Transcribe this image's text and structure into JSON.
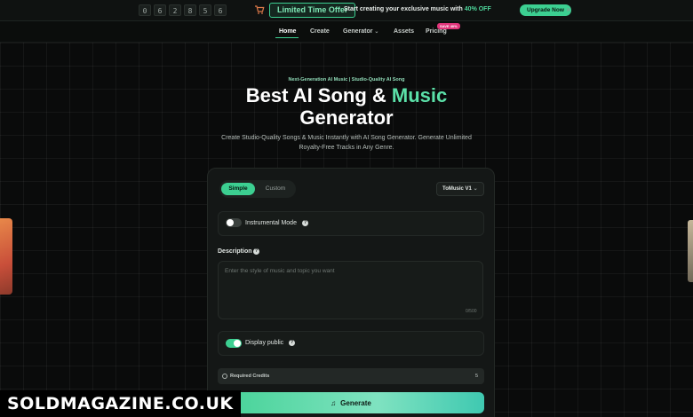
{
  "promo": {
    "countdown": [
      "0",
      "6",
      "2",
      "8",
      "5",
      "6"
    ],
    "offer_label": "Limited Time Offer",
    "text_before": "Start creating your exclusive music with ",
    "text_highlight": "40% OFF",
    "upgrade_label": "Upgrade Now",
    "close_symbol": "×"
  },
  "nav": {
    "items": [
      "Home",
      "Create",
      "Generator",
      "Assets",
      "Pricing"
    ],
    "pricing_badge": "SAVE 40%"
  },
  "hero": {
    "eyebrow": "Next-Generation AI Music | Studio-Quality AI Song",
    "title_part1": "Best AI Song & ",
    "title_accent": "Music",
    "title_part2": "Generator",
    "subtitle": "Create Studio-Quality Songs & Music Instantly with AI Song Generator. Generate Unlimited Royalty-Free Tracks in Any Genre."
  },
  "form": {
    "tabs": [
      "Simple",
      "Custom"
    ],
    "model": "ToMusic V1",
    "instrumental_label": "Instrumental Mode",
    "instrumental_on": false,
    "description_label": "Description",
    "description_placeholder": "Enter the style of music and topic you want",
    "char_count": "0/500",
    "display_public_label": "Display public",
    "display_public_on": true,
    "credits_label": "Required Credits",
    "credits_value": "5",
    "generate_label": "Generate"
  },
  "watermark": "SOLDMAGAZINE.CO.UK",
  "colors": {
    "accent": "#3ccf91",
    "background": "#0a0b0b"
  }
}
